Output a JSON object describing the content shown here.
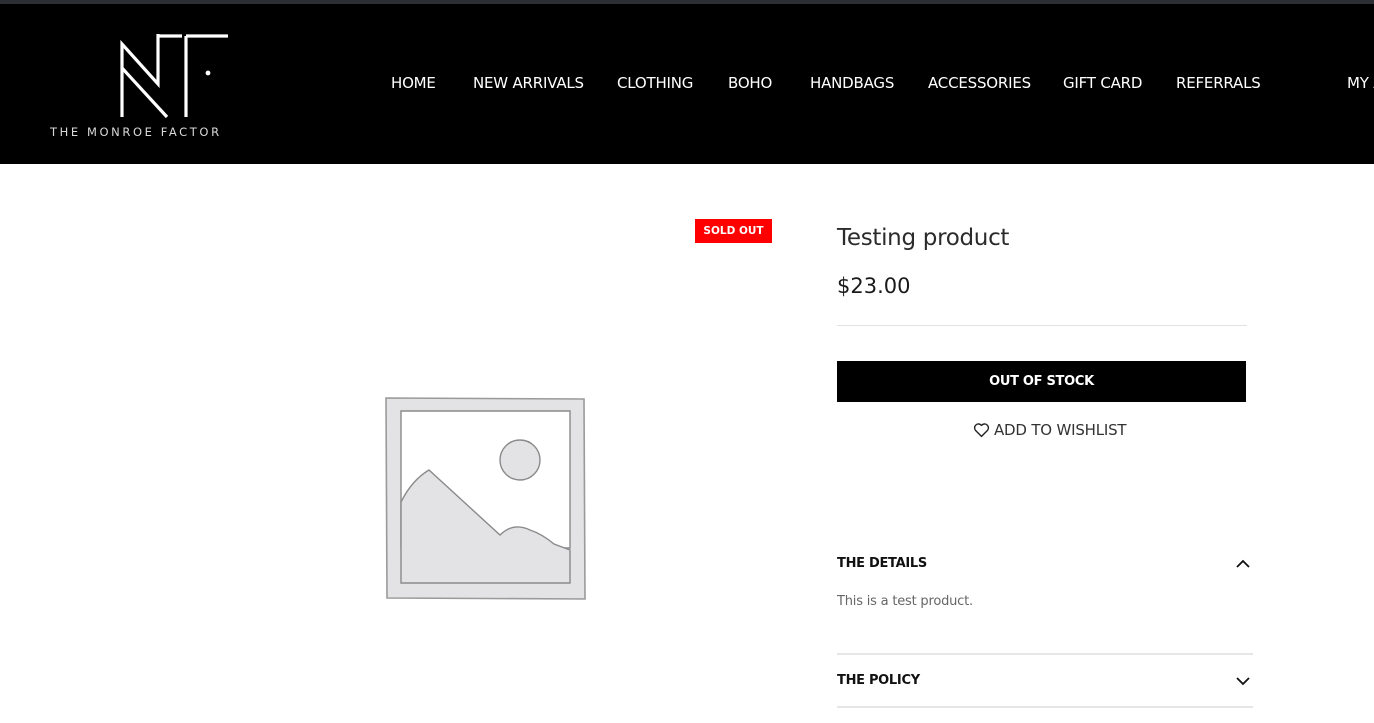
{
  "header": {
    "logo_text": "THE MONROE FACTOR",
    "nav": [
      "HOME",
      "NEW ARRIVALS",
      "CLOTHING",
      "BOHO",
      "HANDBAGS",
      "ACCESSORIES",
      "GIFT CARD",
      "REFERRALS",
      "MY A"
    ]
  },
  "product": {
    "badge": "SOLD OUT",
    "title": "Testing product",
    "price": "$23.00",
    "stock_button": "OUT OF STOCK",
    "wishlist": "ADD TO WISHLIST",
    "image_icon": "image-placeholder-icon"
  },
  "accordion": {
    "details_title": "THE DETAILS",
    "details_body": "This is a test product.",
    "policy_title": "THE POLICY",
    "details_icon": "chevron-up-icon",
    "policy_icon": "chevron-down-icon"
  },
  "colors": {
    "header_bg": "#000000",
    "badge_bg": "#ff0000",
    "button_bg": "#000000"
  }
}
